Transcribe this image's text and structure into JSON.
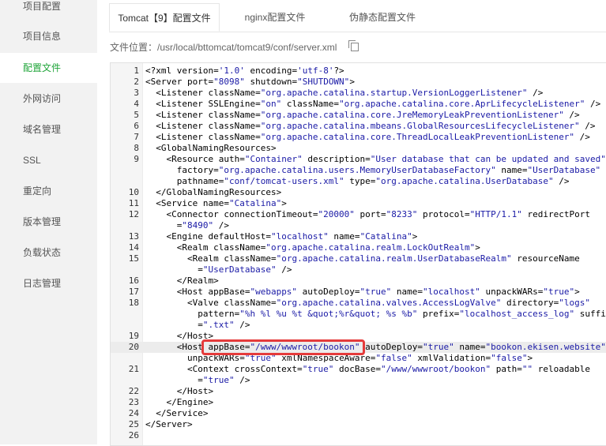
{
  "sidebar": {
    "items": [
      {
        "label": "项目配置",
        "active": false
      },
      {
        "label": "项目信息",
        "active": false
      },
      {
        "label": "配置文件",
        "active": true
      },
      {
        "label": "外网访问",
        "active": false
      },
      {
        "label": "域名管理",
        "active": false
      },
      {
        "label": "SSL",
        "active": false
      },
      {
        "label": "重定向",
        "active": false
      },
      {
        "label": "版本管理",
        "active": false
      },
      {
        "label": "负载状态",
        "active": false
      },
      {
        "label": "日志管理",
        "active": false
      }
    ],
    "active_color": "#20a53a"
  },
  "tabs": [
    {
      "label": "Tomcat【9】配置文件",
      "active": true
    },
    {
      "label": "nginx配置文件",
      "active": false
    },
    {
      "label": "伪静态配置文件",
      "active": false
    }
  ],
  "file": {
    "label": "文件位置：",
    "path": "/usr/local/bttomcat/tomcat9/conf/server.xml",
    "copy_icon": "copy-icon"
  },
  "editor": {
    "highlighted_line": "20",
    "annotation": "red-box-around-appBase",
    "lines": [
      {
        "n": "1",
        "text": "<?xml version='1.0' encoding='utf-8'?>"
      },
      {
        "n": "2",
        "text": "<Server port=\"8098\" shutdown=\"SHUTDOWN\">"
      },
      {
        "n": "3",
        "text": "  <Listener className=\"org.apache.catalina.startup.VersionLoggerListener\" />"
      },
      {
        "n": "4",
        "text": "  <Listener SSLEngine=\"on\" className=\"org.apache.catalina.core.AprLifecycleListener\" />"
      },
      {
        "n": "5",
        "text": "  <Listener className=\"org.apache.catalina.core.JreMemoryLeakPreventionListener\" />"
      },
      {
        "n": "6",
        "text": "  <Listener className=\"org.apache.catalina.mbeans.GlobalResourcesLifecycleListener\" />"
      },
      {
        "n": "7",
        "text": "  <Listener className=\"org.apache.catalina.core.ThreadLocalLeakPreventionListener\" />"
      },
      {
        "n": "8",
        "text": "  <GlobalNamingResources>"
      },
      {
        "n": "9",
        "text": "    <Resource auth=\"Container\" description=\"User database that can be updated and saved\""
      },
      {
        "n": "",
        "text": "      factory=\"org.apache.catalina.users.MemoryUserDatabaseFactory\" name=\"UserDatabase\""
      },
      {
        "n": "",
        "text": "      pathname=\"conf/tomcat-users.xml\" type=\"org.apache.catalina.UserDatabase\" />"
      },
      {
        "n": "10",
        "text": "  </GlobalNamingResources>"
      },
      {
        "n": "11",
        "text": "  <Service name=\"Catalina\">"
      },
      {
        "n": "12",
        "text": "    <Connector connectionTimeout=\"20000\" port=\"8233\" protocol=\"HTTP/1.1\" redirectPort"
      },
      {
        "n": "",
        "text": "      =\"8490\" />"
      },
      {
        "n": "13",
        "text": "    <Engine defaultHost=\"localhost\" name=\"Catalina\">"
      },
      {
        "n": "14",
        "text": "      <Realm className=\"org.apache.catalina.realm.LockOutRealm\">"
      },
      {
        "n": "15",
        "text": "        <Realm className=\"org.apache.catalina.realm.UserDatabaseRealm\" resourceName"
      },
      {
        "n": "",
        "text": "          =\"UserDatabase\" />"
      },
      {
        "n": "16",
        "text": "      </Realm>"
      },
      {
        "n": "17",
        "text": "      <Host appBase=\"webapps\" autoDeploy=\"true\" name=\"localhost\" unpackWARs=\"true\">"
      },
      {
        "n": "18",
        "text": "        <Valve className=\"org.apache.catalina.valves.AccessLogValve\" directory=\"logs\""
      },
      {
        "n": "",
        "text": "          pattern=\"%h %l %u %t &quot;%r&quot; %s %b\" prefix=\"localhost_access_log\" suffix"
      },
      {
        "n": "",
        "text": "          =\".txt\" />"
      },
      {
        "n": "19",
        "text": "      </Host>"
      },
      {
        "n": "20",
        "text": "      <Host appBase=\"/www/wwwroot/bookon\" autoDeploy=\"true\" name=\"bookon.ekisen.website\""
      },
      {
        "n": "",
        "text": "        unpackWARs=\"true\" xmlNamespaceAware=\"false\" xmlValidation=\"false\">"
      },
      {
        "n": "21",
        "text": "        <Context crossContext=\"true\" docBase=\"/www/wwwroot/bookon\" path=\"\" reloadable"
      },
      {
        "n": "",
        "text": "          =\"true\" />"
      },
      {
        "n": "22",
        "text": "      </Host>"
      },
      {
        "n": "23",
        "text": "    </Engine>"
      },
      {
        "n": "24",
        "text": "  </Service>"
      },
      {
        "n": "25",
        "text": "</Server>"
      },
      {
        "n": "26",
        "text": ""
      }
    ]
  }
}
